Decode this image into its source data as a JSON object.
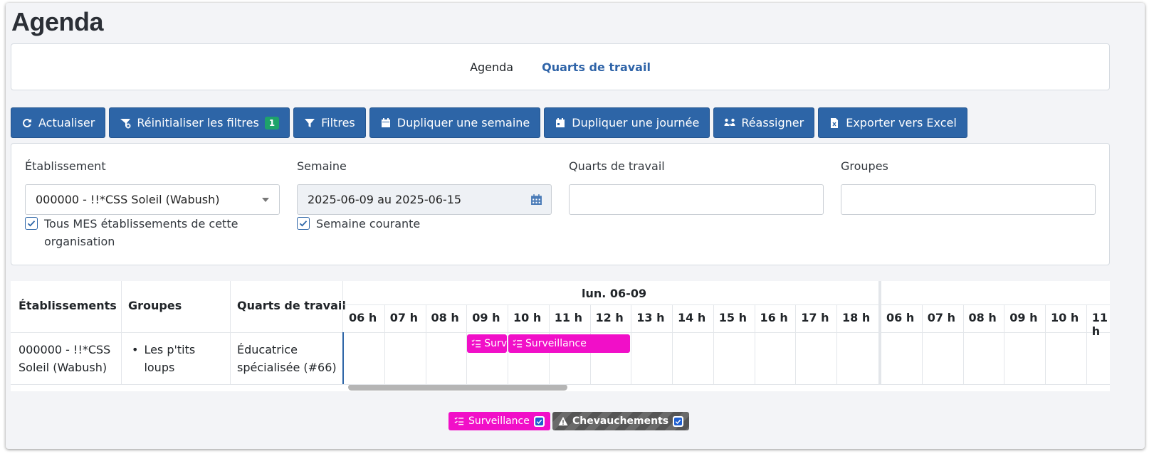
{
  "page": {
    "title": "Agenda"
  },
  "nav": {
    "tabs": [
      {
        "label": "Agenda"
      },
      {
        "label": "Quarts de travail"
      }
    ]
  },
  "toolbar": {
    "refresh": "Actualiser",
    "reset_filters": "Réinitialiser les filtres",
    "reset_filters_count": "1",
    "filters": "Filtres",
    "duplicate_week": "Dupliquer une semaine",
    "duplicate_day": "Dupliquer une journée",
    "reassign": "Réassigner",
    "export_excel": "Exporter vers Excel"
  },
  "filters": {
    "establishment": {
      "label": "Établissement",
      "value": "000000 - !!*CSS Soleil (Wabush)",
      "checkbox_label": "Tous MES établissements de cette organisation",
      "checked": true
    },
    "week": {
      "label": "Semaine",
      "value": "2025-06-09 au 2025-06-15",
      "checkbox_label": "Semaine courante",
      "checked": true
    },
    "shifts": {
      "label": "Quarts de travail",
      "value": ""
    },
    "groups": {
      "label": "Groupes",
      "value": ""
    }
  },
  "schedule": {
    "headers": {
      "establishments": "Établissements",
      "groups": "Groupes",
      "shifts": "Quarts de travail"
    },
    "day1": {
      "title": "lun. 06-09",
      "hours": [
        "06 h",
        "07 h",
        "08 h",
        "09 h",
        "10 h",
        "11 h",
        "12 h",
        "13 h",
        "14 h",
        "15 h",
        "16 h",
        "17 h",
        "18 h"
      ]
    },
    "day2": {
      "title": "",
      "hours": [
        "06 h",
        "07 h",
        "08 h",
        "09 h",
        "10 h",
        "11 h"
      ]
    },
    "row": {
      "establishment": "000000 - !!*CSS Soleil (Wabush)",
      "group": "Les p'tits loups",
      "shift": "Éducatrice spécialisée (#66)"
    },
    "events": [
      {
        "label": "Surveillance",
        "start_hour": "09 h",
        "end_hour": "10 h"
      },
      {
        "label": "Surveillance",
        "start_hour": "10 h",
        "end_hour": "13 h"
      }
    ]
  },
  "legend": {
    "surveillance": {
      "label": "Surveillance",
      "checked": true,
      "color": "#f10fc8"
    },
    "overlaps": {
      "label": "Chevauchements",
      "checked": true
    }
  },
  "colors": {
    "primary": "#2d65a7",
    "event": "#f10fc8",
    "badge": "#1ea36a"
  }
}
